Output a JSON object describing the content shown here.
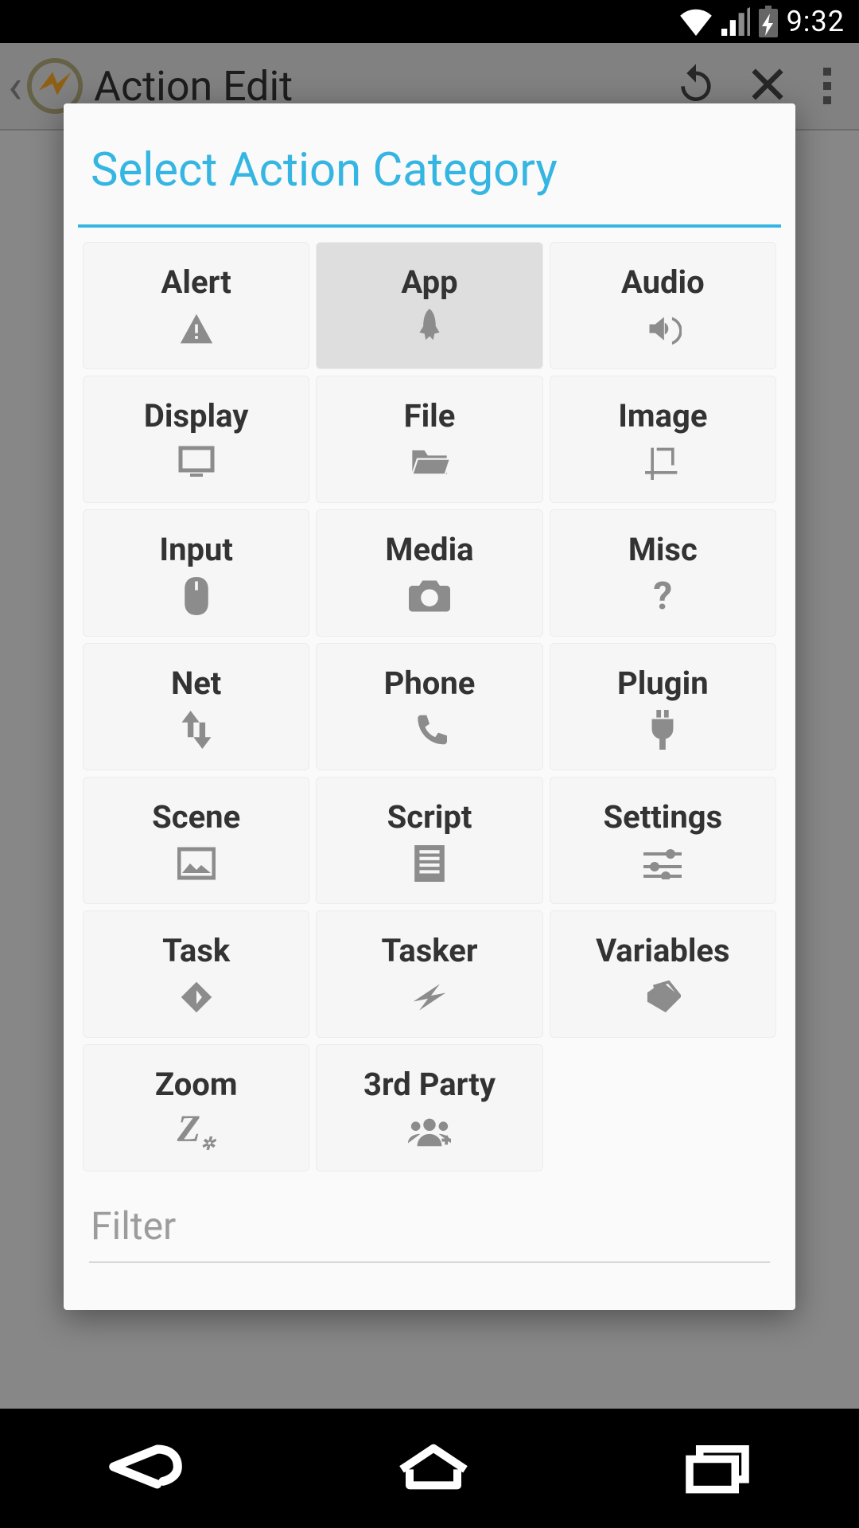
{
  "statusbar": {
    "time": "9:32"
  },
  "header": {
    "title": "Action Edit"
  },
  "dialog": {
    "title": "Select Action Category",
    "filter_placeholder": "Filter",
    "categories": [
      {
        "label": "Alert",
        "icon": "alert-icon"
      },
      {
        "label": "App",
        "icon": "rocket-icon",
        "selected": true
      },
      {
        "label": "Audio",
        "icon": "speaker-icon"
      },
      {
        "label": "Display",
        "icon": "monitor-icon"
      },
      {
        "label": "File",
        "icon": "folder-icon"
      },
      {
        "label": "Image",
        "icon": "crop-icon"
      },
      {
        "label": "Input",
        "icon": "mouse-icon"
      },
      {
        "label": "Media",
        "icon": "camera-icon"
      },
      {
        "label": "Misc",
        "icon": "question-icon"
      },
      {
        "label": "Net",
        "icon": "updown-icon"
      },
      {
        "label": "Phone",
        "icon": "phone-icon"
      },
      {
        "label": "Plugin",
        "icon": "plug-icon"
      },
      {
        "label": "Scene",
        "icon": "picture-icon"
      },
      {
        "label": "Script",
        "icon": "document-icon"
      },
      {
        "label": "Settings",
        "icon": "sliders-icon"
      },
      {
        "label": "Task",
        "icon": "diamond-icon"
      },
      {
        "label": "Tasker",
        "icon": "bolt-icon"
      },
      {
        "label": "Variables",
        "icon": "tag-icon"
      },
      {
        "label": "Zoom",
        "icon": "zoom-icon"
      },
      {
        "label": "3rd Party",
        "icon": "group-icon"
      }
    ]
  }
}
